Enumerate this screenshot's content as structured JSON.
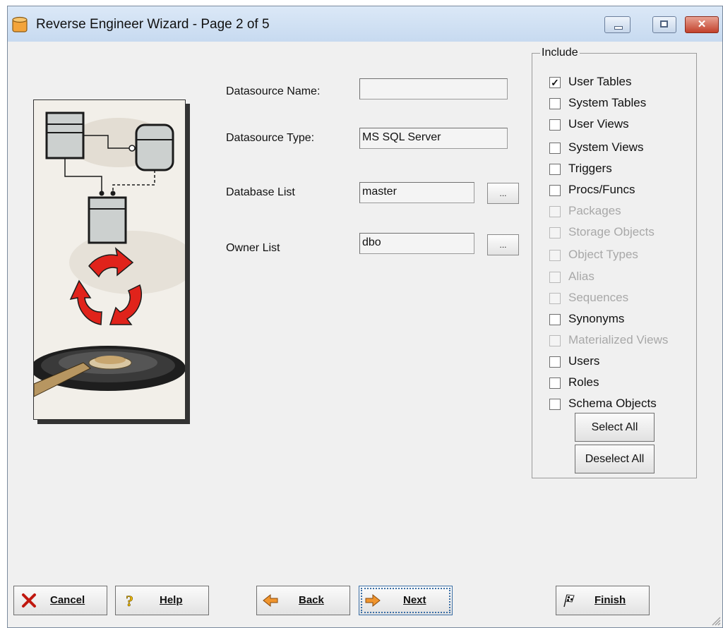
{
  "window": {
    "title": "Reverse Engineer Wizard - Page 2 of 5",
    "close_glyph": "✕"
  },
  "form": {
    "datasource_name_label": "Datasource Name:",
    "datasource_name_value": "",
    "datasource_type_label": "Datasource Type:",
    "datasource_type_value": "MS SQL Server",
    "database_list_label": "Database List",
    "database_list_value": "master",
    "owner_list_label": "Owner List",
    "owner_list_value": "dbo",
    "browse_label": "..."
  },
  "include": {
    "title": "Include",
    "items": [
      {
        "label": "User Tables",
        "checked": true,
        "enabled": true
      },
      {
        "label": "System Tables",
        "checked": false,
        "enabled": true
      },
      {
        "label": "User Views",
        "checked": false,
        "enabled": true
      },
      {
        "label": "System Views",
        "checked": false,
        "enabled": true
      },
      {
        "label": "Triggers",
        "checked": false,
        "enabled": true
      },
      {
        "label": "Procs/Funcs",
        "checked": false,
        "enabled": true
      },
      {
        "label": "Packages",
        "checked": false,
        "enabled": false
      },
      {
        "label": "Storage Objects",
        "checked": false,
        "enabled": false
      },
      {
        "label": "Object Types",
        "checked": false,
        "enabled": false
      },
      {
        "label": "Alias",
        "checked": false,
        "enabled": false
      },
      {
        "label": "Sequences",
        "checked": false,
        "enabled": false
      },
      {
        "label": "Synonyms",
        "checked": false,
        "enabled": true
      },
      {
        "label": "Materialized Views",
        "checked": false,
        "enabled": false
      },
      {
        "label": "Users",
        "checked": false,
        "enabled": true
      },
      {
        "label": "Roles",
        "checked": false,
        "enabled": true
      },
      {
        "label": "Schema Objects",
        "checked": false,
        "enabled": true
      }
    ],
    "select_all_label": "Select All",
    "deselect_all_label": "Deselect All",
    "check_glyph": "✓"
  },
  "buttons": {
    "cancel": "Cancel",
    "help": "Help",
    "back": "Back",
    "next": "Next",
    "finish": "Finish"
  },
  "colors": {
    "arrow_red": "#e0231b",
    "back_arrow": "#f0952e"
  }
}
